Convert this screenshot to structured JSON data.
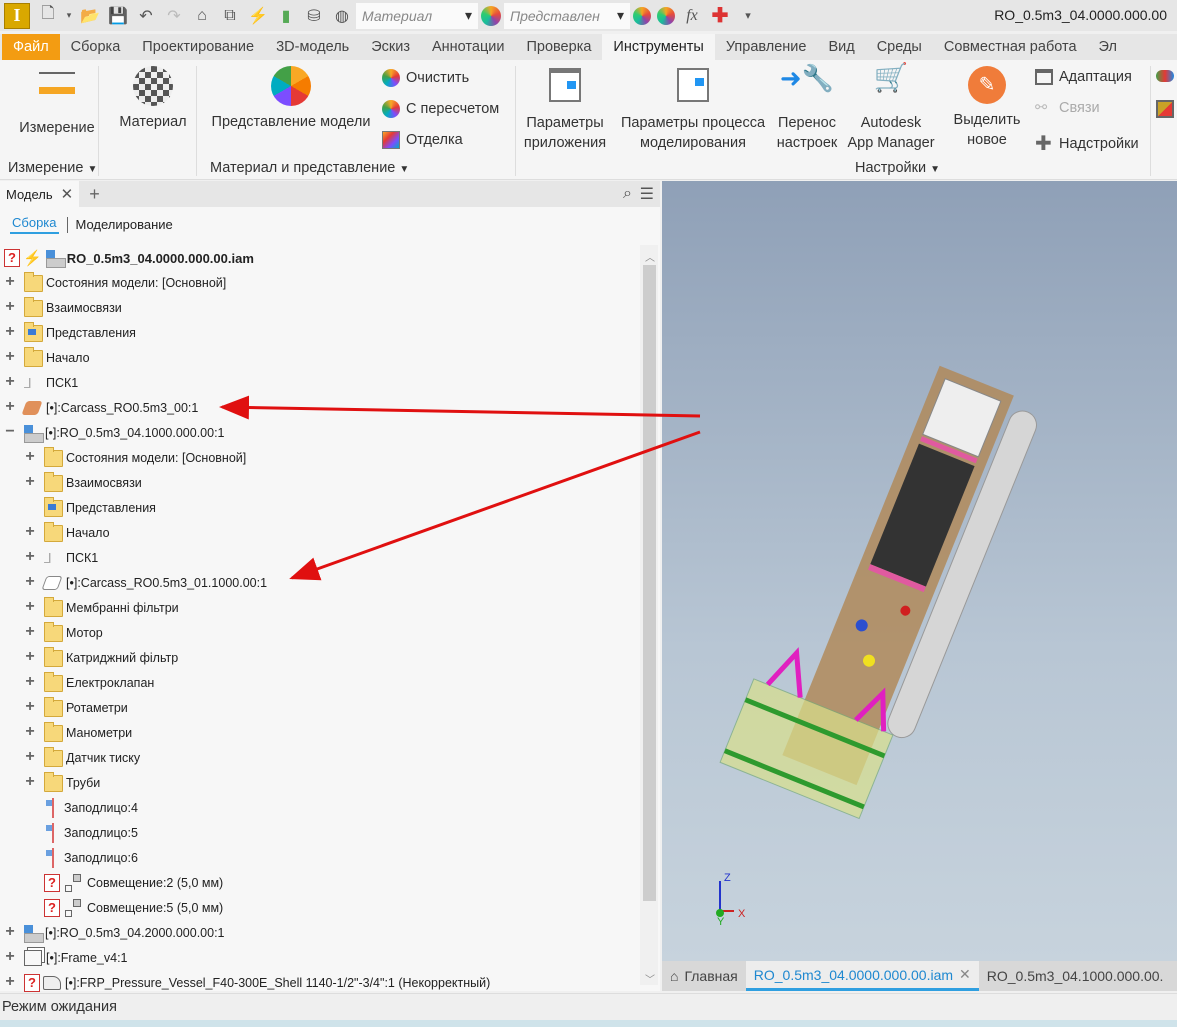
{
  "qat": {
    "material_placeholder": "Материал",
    "appearance_placeholder": "Представлен",
    "document_title": "RO_0.5m3_04.0000.000.00"
  },
  "menu_tabs": [
    "Файл",
    "Сборка",
    "Проектирование",
    "3D-модель",
    "Эскиз",
    "Аннотации",
    "Проверка",
    "Инструменты",
    "Управление",
    "Вид",
    "Среды",
    "Совместная работа",
    "Эл"
  ],
  "active_tab": "Инструменты",
  "ribbon": {
    "measure": "Измерение",
    "material": "Материал",
    "appearance": "Представление модели",
    "clear": "Очистить",
    "adjust": "С пересчетом",
    "finish": "Отделка",
    "app_options_1": "Параметры",
    "app_options_2": "приложения",
    "doc_settings_1": "Параметры процесса",
    "doc_settings_2": "моделирования",
    "migrate_1": "Перенос",
    "migrate_2": "настроек",
    "app_manager_1": "Autodesk",
    "app_manager_2": "App Manager",
    "highlight_1": "Выделить",
    "highlight_2": "новое",
    "customize": "Адаптация",
    "links": "Связи",
    "addins": "Надстройки",
    "groups": {
      "measure": "Измерение",
      "material": "Материал и представление",
      "options": "Настройки"
    }
  },
  "browser": {
    "tab": "Модель",
    "subtab_active": "Сборка",
    "subtab_other": "Моделирование",
    "rows": [
      {
        "level": 0,
        "exp": "",
        "icons": [
          "q",
          "bolt",
          "asm"
        ],
        "label": "RO_0.5m3_04.0000.000.00.iam",
        "bold": true
      },
      {
        "level": 1,
        "exp": "+",
        "icons": [
          "folder"
        ],
        "label": "Состояния модели: [Основной]"
      },
      {
        "level": 1,
        "exp": "+",
        "icons": [
          "folder"
        ],
        "label": "Взаимосвязи"
      },
      {
        "level": 1,
        "exp": "+",
        "icons": [
          "folderv"
        ],
        "label": "Представления"
      },
      {
        "level": 1,
        "exp": "+",
        "icons": [
          "folder"
        ],
        "label": "Начало"
      },
      {
        "level": 1,
        "exp": "+",
        "icons": [
          "ucs"
        ],
        "label": "ПСК1"
      },
      {
        "level": 1,
        "exp": "+",
        "icons": [
          "surf"
        ],
        "label": "[•]:Carcass_RO0.5m3_00:1"
      },
      {
        "level": 1,
        "exp": "−",
        "icons": [
          "asm"
        ],
        "label": "[•]:RO_0.5m3_04.1000.000.00:1"
      },
      {
        "level": 2,
        "exp": "+",
        "icons": [
          "folder"
        ],
        "label": "Состояния модели: [Основной]"
      },
      {
        "level": 2,
        "exp": "+",
        "icons": [
          "folder"
        ],
        "label": "Взаимосвязи"
      },
      {
        "level": 2,
        "exp": "",
        "icons": [
          "folderv"
        ],
        "label": "Представления"
      },
      {
        "level": 2,
        "exp": "+",
        "icons": [
          "folder"
        ],
        "label": "Начало"
      },
      {
        "level": 2,
        "exp": "+",
        "icons": [
          "ucs"
        ],
        "label": "ПСК1"
      },
      {
        "level": 2,
        "exp": "+",
        "icons": [
          "surfw"
        ],
        "label": "[•]:Carcass_RO0.5m3_01.1000.00:1"
      },
      {
        "level": 2,
        "exp": "+",
        "icons": [
          "folder"
        ],
        "label": "Мембранні фільтри"
      },
      {
        "level": 2,
        "exp": "+",
        "icons": [
          "folder"
        ],
        "label": "Мотор"
      },
      {
        "level": 2,
        "exp": "+",
        "icons": [
          "folder"
        ],
        "label": "Катриджний фільтр"
      },
      {
        "level": 2,
        "exp": "+",
        "icons": [
          "folder"
        ],
        "label": "Електроклапан"
      },
      {
        "level": 2,
        "exp": "+",
        "icons": [
          "folder"
        ],
        "label": "Ротаметри"
      },
      {
        "level": 2,
        "exp": "+",
        "icons": [
          "folder"
        ],
        "label": "Манометри"
      },
      {
        "level": 2,
        "exp": "+",
        "icons": [
          "folder"
        ],
        "label": "Датчик тиску"
      },
      {
        "level": 2,
        "exp": "+",
        "icons": [
          "folder"
        ],
        "label": "Труби"
      },
      {
        "level": 2,
        "exp": "",
        "icons": [
          "flush"
        ],
        "label": "Заподлицо:4"
      },
      {
        "level": 2,
        "exp": "",
        "icons": [
          "flush"
        ],
        "label": "Заподлицо:5"
      },
      {
        "level": 2,
        "exp": "",
        "icons": [
          "flush"
        ],
        "label": "Заподлицо:6"
      },
      {
        "level": 2,
        "exp": "",
        "icons": [
          "q",
          "mate"
        ],
        "label": "Совмещение:2 (5,0 мм)"
      },
      {
        "level": 2,
        "exp": "",
        "icons": [
          "q",
          "mate"
        ],
        "label": "Совмещение:5 (5,0 мм)"
      },
      {
        "level": 1,
        "exp": "+",
        "icons": [
          "asm"
        ],
        "label": "[•]:RO_0.5m3_04.2000.000.00:1"
      },
      {
        "level": 1,
        "exp": "+",
        "icons": [
          "frame"
        ],
        "label": "[•]:Frame_v4:1"
      },
      {
        "level": 1,
        "exp": "+",
        "icons": [
          "q",
          "part"
        ],
        "label": "[•]:FRP_Pressure_Vessel_F40-300E_Shell 1140-1/2\"-3/4\":1 (Некорректный)"
      }
    ]
  },
  "viewport": {
    "axes": [
      "X",
      "Y",
      "Z"
    ]
  },
  "doc_tabs": {
    "home": "Главная",
    "active": "RO_0.5m3_04.0000.000.00.iam",
    "other": "RO_0.5m3_04.1000.000.00."
  },
  "status": "Режим ожидания",
  "colors": {
    "file_tab": "#f39c12",
    "accent": "#1e88d0",
    "arrow": "#e01010"
  }
}
